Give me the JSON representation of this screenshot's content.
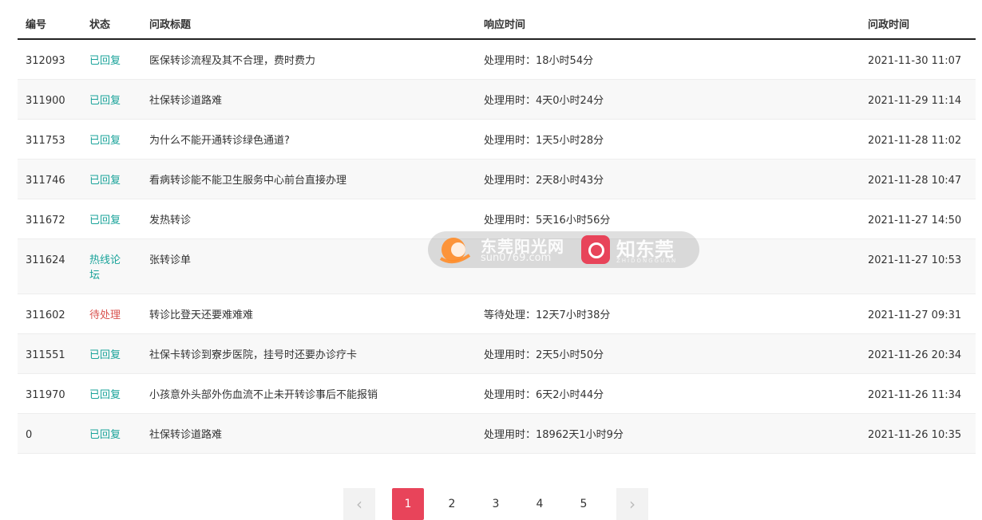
{
  "columns": {
    "id": "编号",
    "status": "状态",
    "title": "问政标题",
    "response": "响应时间",
    "time": "问政时间"
  },
  "rows": [
    {
      "id": "312093",
      "status": "已回复",
      "status_type": "replied",
      "title": "医保转诊流程及其不合理，费时费力",
      "response": "处理用时：18小时54分",
      "time": "2021-11-30 11:07"
    },
    {
      "id": "311900",
      "status": "已回复",
      "status_type": "replied",
      "title": "社保转诊道路难",
      "response": "处理用时：4天0小时24分",
      "time": "2021-11-29 11:14"
    },
    {
      "id": "311753",
      "status": "已回复",
      "status_type": "replied",
      "title": "为什么不能开通转诊绿色通道?",
      "response": "处理用时：1天5小时28分",
      "time": "2021-11-28 11:02"
    },
    {
      "id": "311746",
      "status": "已回复",
      "status_type": "replied",
      "title": "看病转诊能不能卫生服务中心前台直接办理",
      "response": "处理用时：2天8小时43分",
      "time": "2021-11-28 10:47"
    },
    {
      "id": "311672",
      "status": "已回复",
      "status_type": "replied",
      "title": "发热转诊",
      "response": "处理用时：5天16小时56分",
      "time": "2021-11-27 14:50"
    },
    {
      "id": "311624",
      "status": "热线论坛",
      "status_type": "forum",
      "title": "张转诊单",
      "response": "",
      "time": "2021-11-27 10:53"
    },
    {
      "id": "311602",
      "status": "待处理",
      "status_type": "pending",
      "title": "转诊比登天还要难难难",
      "response": "等待处理：12天7小时38分",
      "time": "2021-11-27 09:31"
    },
    {
      "id": "311551",
      "status": "已回复",
      "status_type": "replied",
      "title": "社保卡转诊到寮步医院，挂号时还要办诊疗卡",
      "response": "处理用时：2天5小时50分",
      "time": "2021-11-26 20:34"
    },
    {
      "id": "311970",
      "status": "已回复",
      "status_type": "replied",
      "title": "小孩意外头部外伤血流不止未开转诊事后不能报销",
      "response": "处理用时：6天2小时44分",
      "time": "2021-11-26 11:34"
    },
    {
      "id": "0",
      "status": "已回复",
      "status_type": "replied",
      "title": "社保转诊道路难",
      "response": "处理用时：18962天1小时9分",
      "time": "2021-11-26 10:35"
    }
  ],
  "pagination": {
    "prev_icon": "chevron-left-icon",
    "next_icon": "chevron-right-icon",
    "pages": [
      "1",
      "2",
      "3",
      "4",
      "5"
    ],
    "current": "1"
  },
  "watermark": {
    "brand1": "东莞阳光网",
    "brand1_url": "sun0769.com",
    "brand2": "知东莞",
    "brand2_sub": "ZHIDONGGUAN"
  },
  "colors": {
    "replied": "#1aa39a",
    "pending": "#d9534f",
    "accent": "#e8445a"
  }
}
